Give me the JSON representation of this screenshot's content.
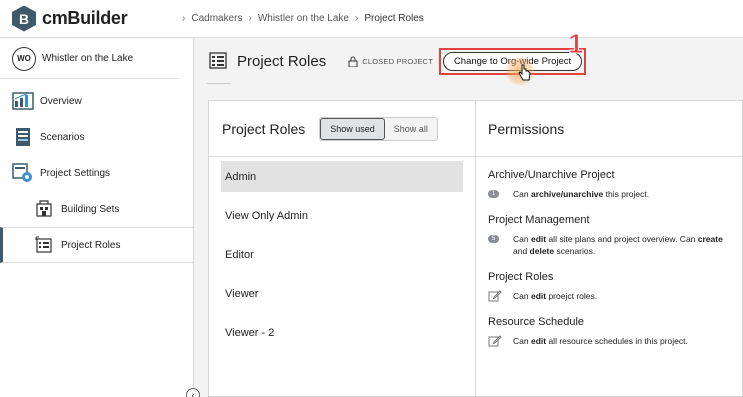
{
  "app": {
    "logo_letter": "B",
    "name": "cmBuilder"
  },
  "breadcrumb": [
    "Cadmakers",
    "Whistler on the Lake",
    "Project Roles"
  ],
  "sidebar": {
    "project_badge": "WO",
    "project_name": "Whistler on the Lake",
    "items": [
      {
        "label": "Overview",
        "icon": "overview-icon"
      },
      {
        "label": "Scenarios",
        "icon": "scenarios-icon"
      },
      {
        "label": "Project Settings",
        "icon": "project-settings-icon"
      },
      {
        "label": "Building Sets",
        "icon": "building-sets-icon"
      },
      {
        "label": "Project Roles",
        "icon": "project-roles-icon"
      }
    ],
    "collapse_glyph": "‹"
  },
  "header": {
    "title": "Project Roles",
    "status": "CLOSED PROJECT",
    "action_label": "Change to Org-wide Project",
    "step_number": "1"
  },
  "roles_panel": {
    "title": "Project Roles",
    "toggle": [
      "Show used",
      "Show all"
    ],
    "roles": [
      "Admin",
      "View Only Admin",
      "Editor",
      "Viewer",
      "Viewer - 2"
    ]
  },
  "permissions_panel": {
    "title": "Permissions",
    "groups": [
      {
        "title": "Archive/Unarchive Project",
        "badge": "1",
        "pre": "Can ",
        "bold1": "archive/unarchive",
        "mid": " this project.",
        "bold2": "",
        "post": ""
      },
      {
        "title": "Project Management",
        "badge": "5",
        "pre": "Can ",
        "bold1": "edit",
        "mid": " all site plans and project overview. Can ",
        "bold2": "create",
        "and": " and ",
        "bold3": "delete",
        "post": " scenarios."
      },
      {
        "title": "Project Roles",
        "badge": "",
        "pre": "Can ",
        "bold1": "edit",
        "mid": " proejct roles.",
        "bold2": "",
        "post": ""
      },
      {
        "title": "Resource Schedule",
        "badge": "",
        "pre": "Can ",
        "bold1": "edit",
        "mid": " all resource schedules in this project.",
        "bold2": "",
        "post": ""
      }
    ]
  },
  "colors": {
    "accent": "#3f5a6b",
    "highlight": "#e0433f"
  }
}
